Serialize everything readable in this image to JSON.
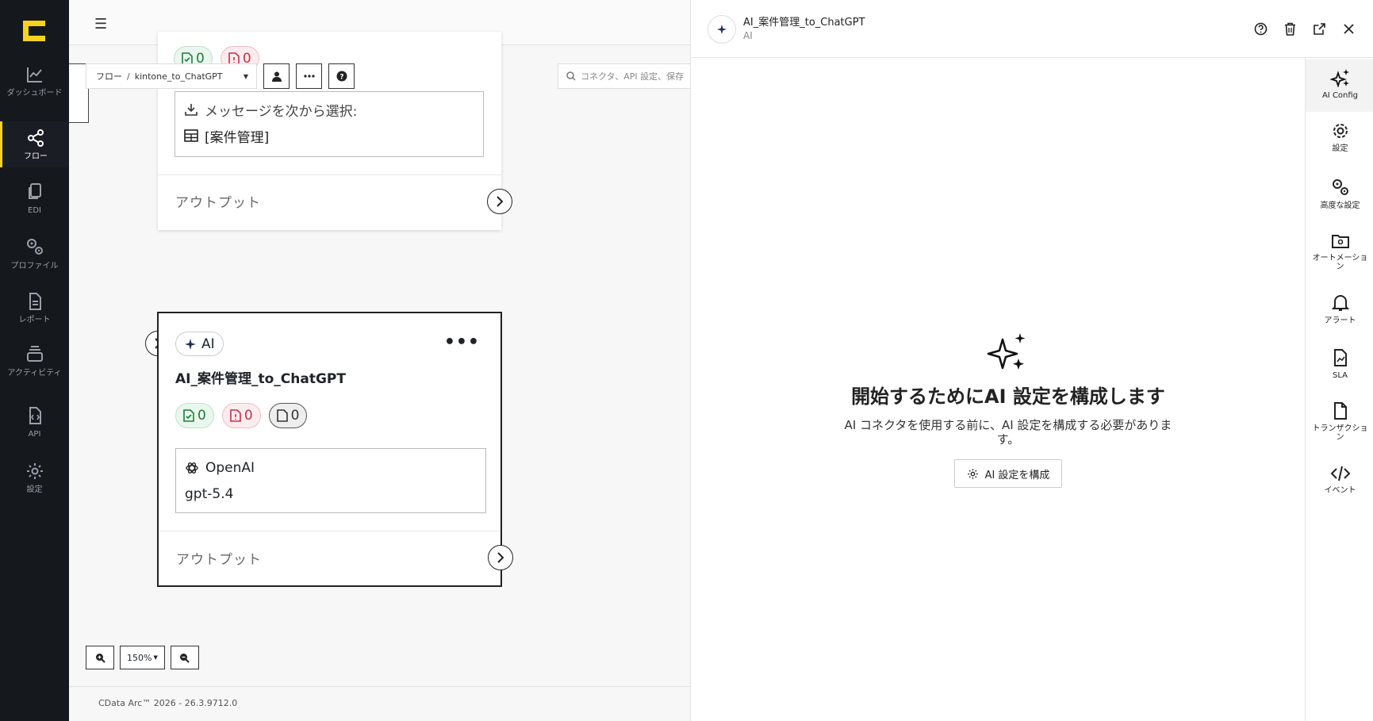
{
  "nav": {
    "items": [
      {
        "label": "ダッシュボード"
      },
      {
        "label": "フロー"
      },
      {
        "label": "EDI"
      },
      {
        "label": "プロファイル"
      },
      {
        "label": "レポート"
      },
      {
        "label": "アクティビティ"
      },
      {
        "label": "API"
      },
      {
        "label": "設定"
      }
    ]
  },
  "canvas": {
    "breadcrumb": {
      "root": "フロー",
      "separator": "/",
      "flow": "kintone_to_ChatGPT"
    },
    "search_placeholder": "コネクタ、API 設定、保存",
    "top_node": {
      "success_count": "0",
      "error_count": "0",
      "message_label": "メッセージを次から選択:",
      "message_value": "[案件管理]",
      "output_label": "アウトプット"
    },
    "ai_node": {
      "tag": "AI",
      "title": "AI_案件管理_to_ChatGPT",
      "success_count": "0",
      "error_count": "0",
      "pending_count": "0",
      "provider": "OpenAI",
      "model": "gpt-5.4",
      "output_label": "アウトプット"
    },
    "zoom": "150%",
    "footer": "CData Arc™ 2026 - 26.3.9712.0"
  },
  "panel": {
    "title": "AI_案件管理_to_ChatGPT",
    "subtitle": "AI",
    "empty_title": "開始するためにAI 設定を構成します",
    "empty_desc": "AI コネクタを使用する前に、AI 設定を構成する必要があります。",
    "configure_button": "AI 設定を構成",
    "rail": [
      {
        "label": "AI Config"
      },
      {
        "label": "設定"
      },
      {
        "label": "高度な設定"
      },
      {
        "label": "オートメーション"
      },
      {
        "label": "アラート"
      },
      {
        "label": "SLA"
      },
      {
        "label": "トランザクション"
      },
      {
        "label": "イベント"
      }
    ]
  },
  "colors": {
    "accent": "#f8d31c",
    "sidebar": "#15181d",
    "success": "#1e7d3b",
    "error": "#c4314b"
  }
}
